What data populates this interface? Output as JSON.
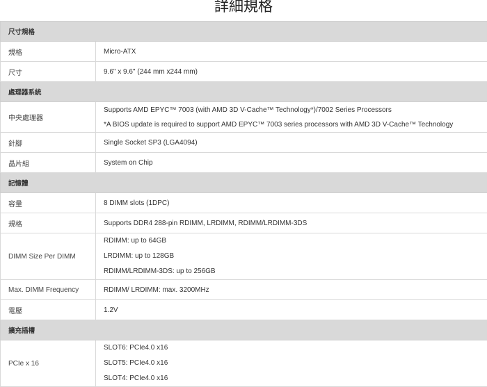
{
  "title": "詳細規格",
  "sections": [
    {
      "name": "尺寸規格",
      "rows": [
        {
          "label": "規格",
          "lines": [
            "Micro-ATX"
          ]
        },
        {
          "label": "尺寸",
          "lines": [
            "9.6\" x 9.6\" (244 mm x244 mm)"
          ]
        }
      ]
    },
    {
      "name": "處理器系統",
      "rows": [
        {
          "label": "中央處理器",
          "lines": [
            "Supports AMD EPYC™ 7003 (with AMD 3D V-Cache™ Technology*)/7002 Series Processors",
            "*A BIOS update is required to support AMD EPYC™ 7003 series processors with AMD 3D V-Cache™ Technology"
          ]
        },
        {
          "label": "針腳",
          "lines": [
            "Single Socket SP3 (LGA4094)"
          ]
        },
        {
          "label": "晶片組",
          "lines": [
            "System on Chip"
          ]
        }
      ]
    },
    {
      "name": "記憶體",
      "rows": [
        {
          "label": "容量",
          "lines": [
            "8 DIMM slots (1DPC)"
          ]
        },
        {
          "label": "規格",
          "lines": [
            "Supports DDR4 288-pin RDIMM, LRDIMM, RDIMM/LRDIMM-3DS"
          ]
        },
        {
          "label": "DIMM Size Per DIMM",
          "lines": [
            "RDIMM: up to 64GB",
            "LRDIMM: up to 128GB",
            "RDIMM/LRDIMM-3DS: up to 256GB"
          ]
        },
        {
          "label": "Max. DIMM Frequency",
          "lines": [
            "RDIMM/ LRDIMM: max. 3200MHz"
          ]
        },
        {
          "label": "電壓",
          "lines": [
            "1.2V"
          ]
        }
      ]
    },
    {
      "name": "擴充插槽",
      "rows": [
        {
          "label": "PCIe x 16",
          "lines": [
            "SLOT6: PCIe4.0 x16",
            "SLOT5: PCIe4.0 x16",
            "SLOT4: PCIe4.0 x16"
          ]
        }
      ]
    }
  ]
}
